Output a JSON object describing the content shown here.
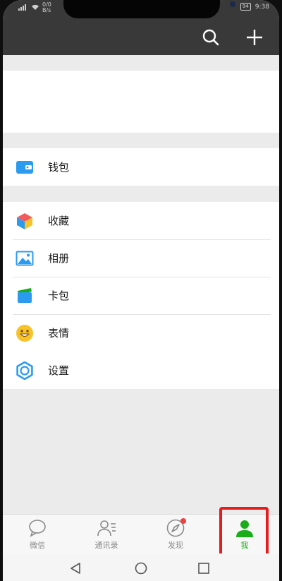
{
  "status_bar": {
    "net_speed_top": "0/0",
    "net_speed_unit": "B/s",
    "battery": "94",
    "time": "9:38"
  },
  "menu": {
    "wallet": "钱包",
    "favorites": "收藏",
    "album": "相册",
    "cards": "卡包",
    "stickers": "表情",
    "settings": "设置"
  },
  "tabs": [
    {
      "label": "微信",
      "icon": "chat-bubble-icon"
    },
    {
      "label": "通讯录",
      "icon": "contacts-icon"
    },
    {
      "label": "发现",
      "icon": "compass-icon",
      "badge": true
    },
    {
      "label": "我",
      "icon": "person-icon",
      "active": true
    }
  ],
  "colors": {
    "header_bg": "#393939",
    "active_tab": "#1aad19",
    "badge": "#f04141",
    "highlight": "#e21e1e",
    "wallet_icon": "#2b9bf0",
    "settings_icon": "#2b9bf0",
    "stickers_icon": "#f7c32a"
  }
}
